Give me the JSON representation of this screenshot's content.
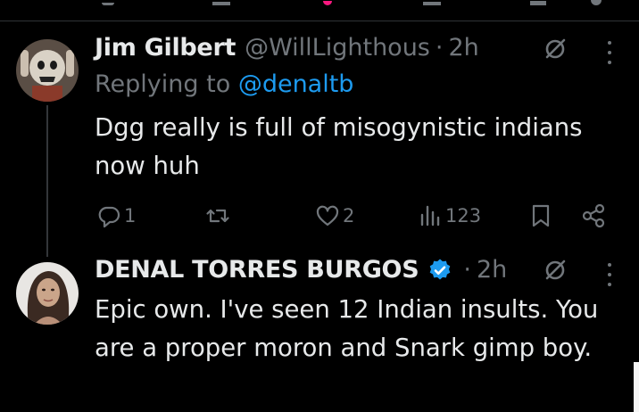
{
  "posts": [
    {
      "author_name": "Jim Gilbert",
      "author_handle": "@WillLighthous",
      "separator": "·",
      "time": "2h",
      "reply_prefix": "Replying to",
      "reply_to": "@denaltb",
      "text": "Dgg really is full of misogynistic indians now huh",
      "actions": {
        "reply_count": "1",
        "repost_count": "",
        "like_count": "2",
        "views_count": "123"
      }
    },
    {
      "author_name": "DENAL TORRES BURGOS",
      "separator": "·",
      "time": "2h",
      "verified": true,
      "text": "Epic own. I've seen 12 Indian insults. You are a proper moron and Snark gimp boy."
    }
  ],
  "icons": {
    "reply": "reply-icon",
    "repost": "repost-icon",
    "like": "heart-icon",
    "views": "views-icon",
    "bookmark": "bookmark-icon",
    "share": "share-icon",
    "edit": "edit-icon",
    "more": "more-icon",
    "verified": "verified-badge-icon"
  },
  "colors": {
    "background": "#000000",
    "text_primary": "#e7e9ea",
    "text_secondary": "#71767b",
    "link": "#1d9bf0",
    "like_accent": "#f91880",
    "verified": "#1d9bf0",
    "thread_line": "#333639"
  }
}
